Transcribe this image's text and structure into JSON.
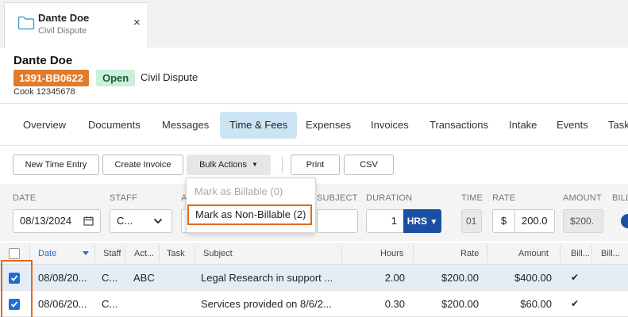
{
  "tab": {
    "title": "Dante Doe",
    "subtitle": "Civil Dispute",
    "close": "×"
  },
  "case": {
    "name": "Dante Doe",
    "number": "1391-BB0622",
    "status": "Open",
    "type": "Civil Dispute",
    "sub": "Cook 12345678"
  },
  "nav": [
    "Overview",
    "Documents",
    "Messages",
    "Time & Fees",
    "Expenses",
    "Invoices",
    "Transactions",
    "Intake",
    "Events",
    "Task"
  ],
  "toolbar": {
    "new_time_entry": "New Time Entry",
    "create_invoice": "Create Invoice",
    "bulk_actions": "Bulk Actions",
    "print": "Print",
    "csv": "CSV"
  },
  "bulk_menu": {
    "mark_billable": "Mark as Billable (0)",
    "mark_non_billable": "Mark as Non-Billable (2)"
  },
  "filters": {
    "labels": {
      "date": "DATE",
      "staff": "STAFF",
      "activity": "A",
      "subject": "SUBJECT",
      "duration": "DURATION",
      "time": "TIME",
      "rate": "RATE",
      "amount": "AMOUNT",
      "billable": "BILL"
    },
    "date_value": "08/13/2024",
    "staff_value": "C...",
    "duration_value": "1",
    "duration_unit": "HRS",
    "time_value": "01",
    "rate_symbol": "$",
    "rate_value": "200.0",
    "amount_value": "$200."
  },
  "table": {
    "headers": [
      "Date",
      "Staff",
      "Act...",
      "Task",
      "Subject",
      "Hours",
      "Rate",
      "Amount",
      "Bill...",
      "Bill..."
    ],
    "rows": [
      {
        "date": "08/08/20...",
        "staff": "C...",
        "activity": "ABC",
        "task": "",
        "subject": "Legal Research in support ...",
        "hours": "2.00",
        "rate": "$200.00",
        "amount": "$400.00",
        "billable": "✔",
        "selected": true
      },
      {
        "date": "08/06/20...",
        "staff": "C...",
        "activity": "",
        "task": "",
        "subject": "Services provided on 8/6/2...",
        "hours": "0.30",
        "rate": "$200.00",
        "amount": "$60.00",
        "billable": "✔",
        "selected": true
      }
    ]
  },
  "colors": {
    "accent_orange": "#e07b2c",
    "highlight_orange": "#e06a1b",
    "primary_blue": "#1b4fa3",
    "active_tab": "#cbe4f3",
    "open_badge": "#c9f0d9"
  }
}
